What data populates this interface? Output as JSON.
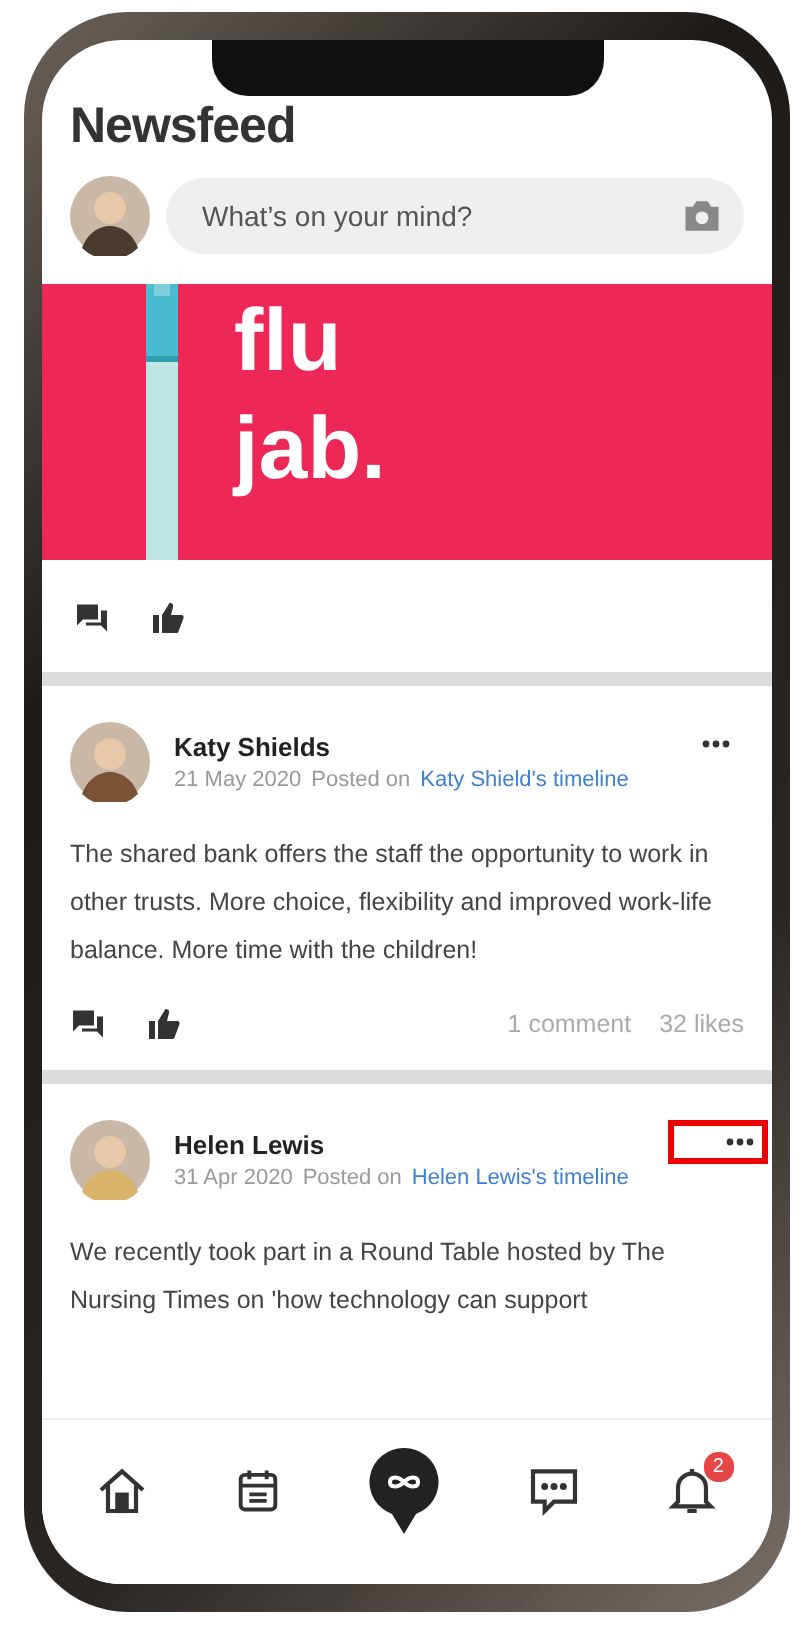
{
  "header": {
    "title": "Newsfeed"
  },
  "composer": {
    "placeholder": "What’s on your mind?"
  },
  "banner": {
    "kind": "picture",
    "lines": [
      "flu",
      "jab."
    ]
  },
  "posts": [
    {
      "author": "Katy Shields",
      "date": "21 May 2020",
      "posted_on": "Posted on",
      "timeline": "Katy Shield's timeline",
      "highlighted": false,
      "text": "The shared bank offers the staff the opportunity to work in other trusts. More choice, flexibility and improved work-life balance. More time with the children!",
      "comments": "1 comment",
      "likes": "32 likes"
    },
    {
      "author": "Helen Lewis",
      "date": "31 Apr 2020",
      "posted_on": "Posted on",
      "timeline": "Helen Lewis's timeline",
      "highlighted": true,
      "text": "We recently took part in a Round Table hosted by The Nursing Times on 'how technology can support"
    }
  ],
  "nav": [
    {
      "kind": "home"
    },
    {
      "kind": "calendar"
    },
    {
      "kind": "center"
    },
    {
      "kind": "chat"
    },
    {
      "kind": "bell",
      "badge": "2"
    }
  ]
}
